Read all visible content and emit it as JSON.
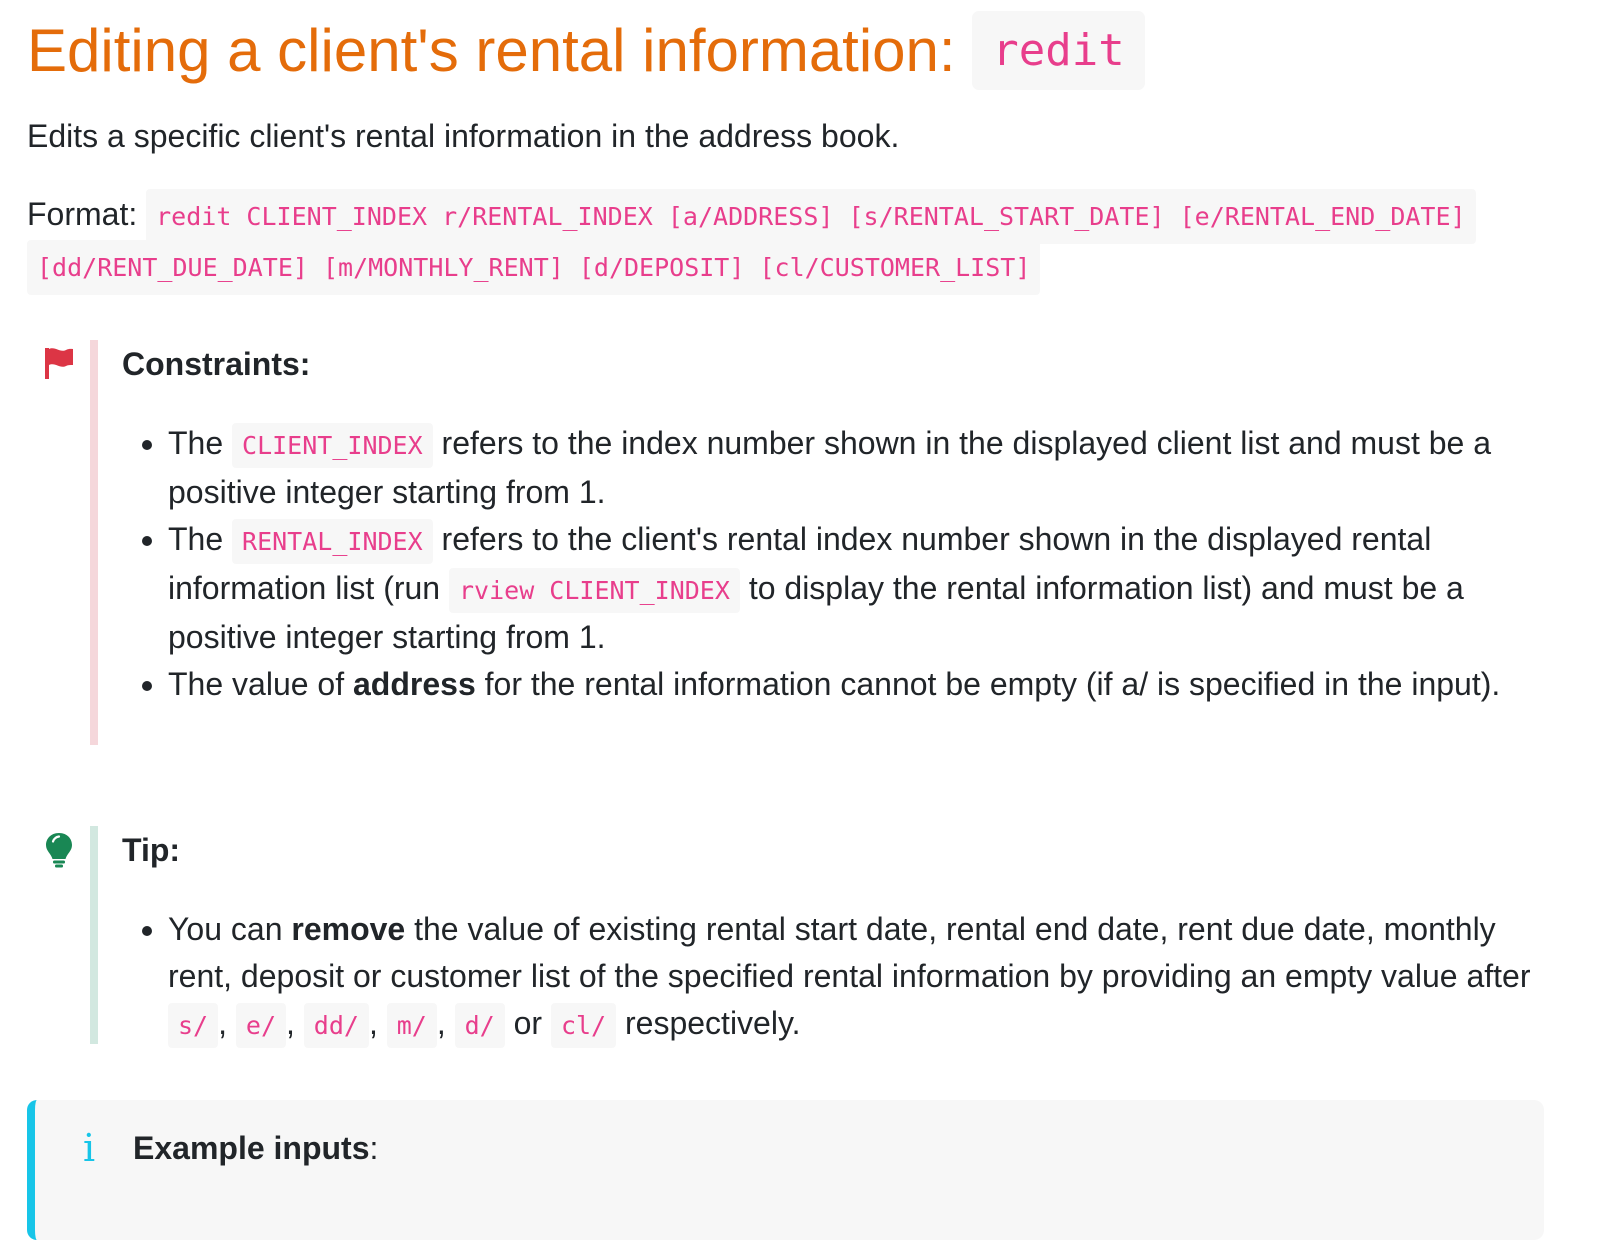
{
  "heading": {
    "title": "Editing a client's rental information: ",
    "command": "redit"
  },
  "intro": "Edits a specific client's rental information in the address book.",
  "format": {
    "label": "Format:",
    "syntax": "redit CLIENT_INDEX r/RENTAL_INDEX [a/ADDRESS] [s/RENTAL_START_DATE] [e/RENTAL_END_DATE] [dd/RENT_DUE_DATE] [m/MONTHLY_RENT] [d/DEPOSIT] [cl/CUSTOMER_LIST]"
  },
  "constraints": {
    "icon": "flag-icon",
    "title": "Constraints:",
    "items": [
      {
        "t1": "The ",
        "c1": "CLIENT_INDEX",
        "t2": " refers to the index number shown in the displayed client list and must be a positive integer starting from 1."
      },
      {
        "t1": "The ",
        "c1": "RENTAL_INDEX",
        "t2": " refers to the client's rental index number shown in the displayed rental information list (run ",
        "c2": "rview CLIENT_INDEX",
        "t3": " to display the rental information list) and must be a positive integer starting from 1."
      },
      {
        "t1": "The value of ",
        "b1": "address",
        "t2": " for the rental information cannot be empty (if a/ is specified in the input)."
      }
    ]
  },
  "tip": {
    "icon": "lightbulb-icon",
    "title": "Tip:",
    "item": {
      "t1": "You can ",
      "b1": "remove",
      "t2": " the value of existing rental start date, rental end date, rent due date, monthly rent, deposit or customer list of the specified rental information by providing an empty value after ",
      "c1": "s/",
      "s1": ", ",
      "c2": "e/",
      "s2": ", ",
      "c3": "dd/",
      "s3": ", ",
      "c4": "m/",
      "s4": ", ",
      "c5": "d/",
      "s5": " or ",
      "c6": "cl/",
      "t3": " respectively."
    }
  },
  "info": {
    "icon": "info-icon",
    "glyph": "i",
    "title": "Example inputs",
    "colon": ":"
  },
  "colors": {
    "heading": "#e46c0a",
    "code_text": "#e83e8c",
    "code_bg": "#f7f7f7",
    "constraints_bar": "#f5d7db",
    "flag_icon": "#dc3545",
    "tip_bar": "#d2e8e0",
    "bulb_icon": "#198754",
    "info_accent": "#17c5e8"
  }
}
